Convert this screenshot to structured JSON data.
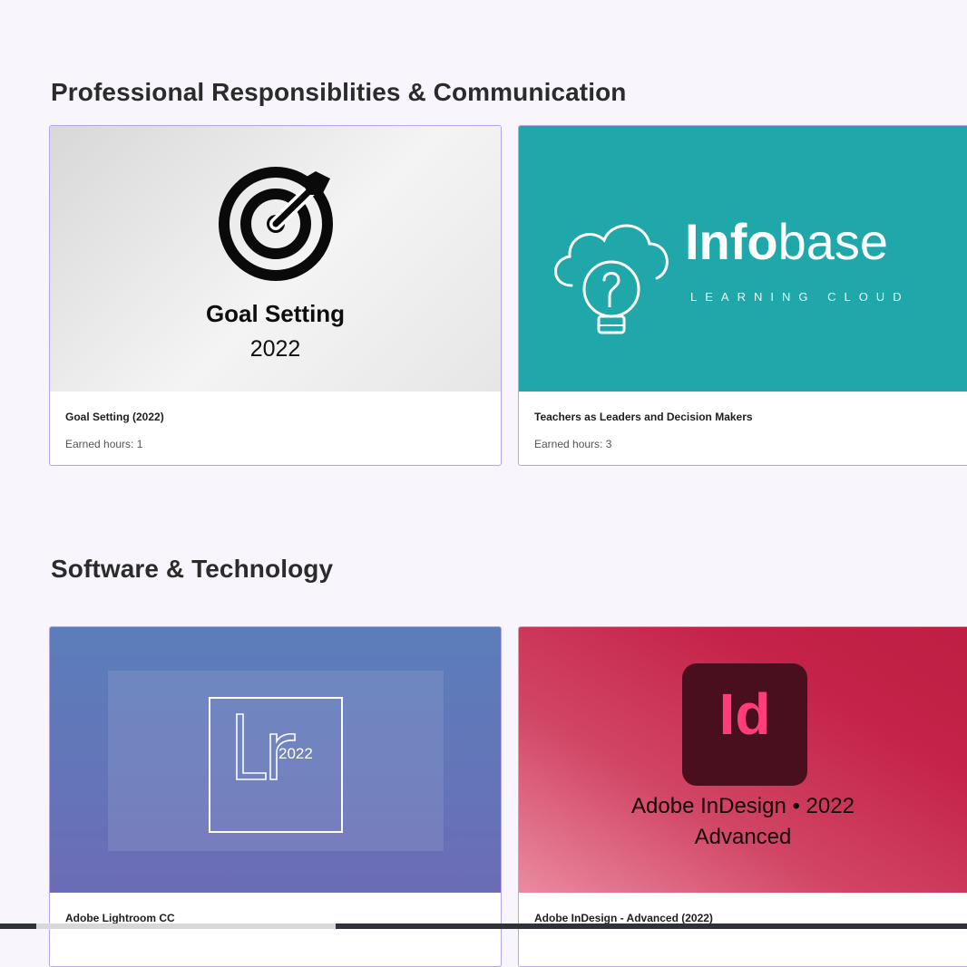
{
  "sections": [
    {
      "title": "Professional Responsiblities & Communication",
      "cards": [
        {
          "title": "Goal Setting (2022)",
          "meta": "Earned hours: 1",
          "thumb": {
            "line1": "Goal Setting",
            "line2": "2022",
            "icon": "target-arrow-icon"
          }
        },
        {
          "title": "Teachers as Leaders and Decision Makers",
          "meta": "Earned hours: 3",
          "thumb": {
            "brand_bold": "Info",
            "brand_light": "base",
            "subtitle": "LEARNING CLOUD",
            "icon": "cloud-lightbulb-icon",
            "bg": "#1fa7aa"
          }
        }
      ]
    },
    {
      "title": "Software & Technology",
      "cards": [
        {
          "title": "Adobe Lightroom CC",
          "meta": "",
          "thumb": {
            "logo": "Lr",
            "year": "2022",
            "icon": "lightroom-logo-icon"
          }
        },
        {
          "title": "Adobe InDesign - Advanced (2022)",
          "meta": "",
          "thumb": {
            "logo": "Id",
            "line1": "Adobe InDesign • 2022",
            "line2": "Advanced",
            "icon": "indesign-logo-icon"
          }
        }
      ]
    }
  ],
  "colors": {
    "page_bg": "#f8f5fd",
    "card_border": "#b7a6e6",
    "infobase_teal": "#1fa7aa",
    "indesign_dark": "#4a0f1f",
    "indesign_pink": "#ff3d7a"
  }
}
